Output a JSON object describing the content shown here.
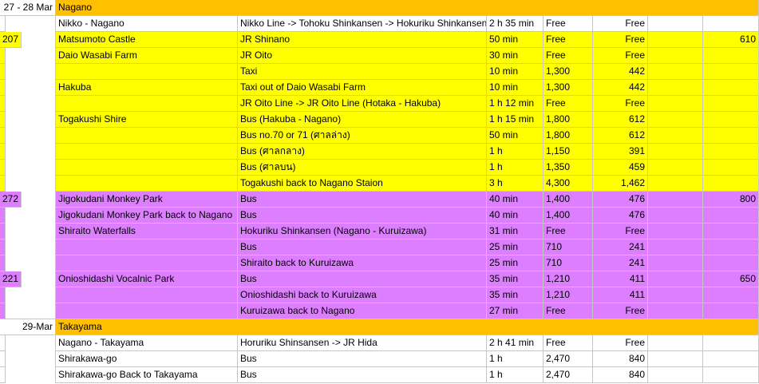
{
  "colors": {
    "header": "#ffc000",
    "nagano_block": "#ffff00",
    "monkey_block": "#dd7eff",
    "white": "#ffffff",
    "gridline": "#c6c6c6"
  },
  "rows": [
    {
      "bg": "header",
      "date": "27 - 28 Mar",
      "cells": [
        "Nagano",
        "",
        "",
        "",
        "",
        "",
        "",
        ""
      ]
    },
    {
      "bg": "white",
      "cells": [
        "Nikko - Nagano",
        "Nikko Line -> Tohoku Shinkansen -> Hokuriku Shinkansen",
        "2 h  35 min",
        "Free",
        "Free",
        "",
        "",
        ""
      ]
    },
    {
      "bg": "nagano_block",
      "cells": [
        "Matsumoto Castle",
        "JR Shinano",
        "50 min",
        "Free",
        "Free",
        "",
        "610",
        "207"
      ]
    },
    {
      "bg": "nagano_block",
      "cells": [
        "Daio Wasabi Farm",
        "JR Oito",
        "30 min",
        "Free",
        "Free",
        "",
        "",
        ""
      ]
    },
    {
      "bg": "nagano_block",
      "cells": [
        "",
        "Taxi",
        "10 min",
        "1,300",
        "442",
        "",
        "",
        ""
      ]
    },
    {
      "bg": "nagano_block",
      "cells": [
        "Hakuba",
        "Taxi out of Daio Wasabi Farm",
        "10 min",
        "1,300",
        "442",
        "",
        "",
        ""
      ]
    },
    {
      "bg": "nagano_block",
      "cells": [
        "",
        "JR Oito Line -> JR Oito Line (Hotaka - Hakuba)",
        "1 h  12 min",
        "Free",
        "Free",
        "",
        "",
        ""
      ]
    },
    {
      "bg": "nagano_block",
      "cells": [
        "Togakushi Shire",
        "Bus (Hakuba - Nagano)",
        "1 h  15 min",
        "1,800",
        "612",
        "",
        "",
        ""
      ]
    },
    {
      "bg": "nagano_block",
      "cells": [
        "",
        "Bus no.70 or 71 (ศาลล่าง)",
        "50 min",
        "1,800",
        "612",
        "",
        "",
        ""
      ]
    },
    {
      "bg": "nagano_block",
      "cells": [
        "",
        "Bus (ศาลกลาง)",
        "1 h",
        "1,150",
        "391",
        "",
        "",
        ""
      ]
    },
    {
      "bg": "nagano_block",
      "cells": [
        "",
        "Bus (ศาลบน)",
        "1 h",
        "1,350",
        "459",
        "",
        "",
        ""
      ]
    },
    {
      "bg": "nagano_block",
      "cells": [
        "",
        "Togakushi back to Nagano Staion",
        "3 h",
        "4,300",
        "1,462",
        "",
        "",
        ""
      ]
    },
    {
      "bg": "monkey_block",
      "cells": [
        "Jigokudani Monkey Park",
        "Bus",
        "40 min",
        "1,400",
        "476",
        "",
        "800",
        "272"
      ]
    },
    {
      "bg": "monkey_block",
      "cells": [
        "Jigokudani Monkey Park back to Nagano",
        "Bus",
        "40 min",
        "1,400",
        "476",
        "",
        "",
        ""
      ]
    },
    {
      "bg": "monkey_block",
      "cells": [
        "Shiraito Waterfalls",
        "Hokuriku Shinkansen (Nagano - Kuruizawa)",
        "31 min",
        "Free",
        "Free",
        "",
        "",
        ""
      ]
    },
    {
      "bg": "monkey_block",
      "cells": [
        "",
        "Bus",
        "25 min",
        "710",
        "241",
        "",
        "",
        ""
      ]
    },
    {
      "bg": "monkey_block",
      "cells": [
        "",
        "Shiraito back to Kuruizawa",
        "25 min",
        "710",
        "241",
        "",
        "",
        ""
      ]
    },
    {
      "bg": "monkey_block",
      "cells": [
        "Onioshidashi Vocalnic Park",
        "Bus",
        "35 min",
        "1,210",
        "411",
        "",
        "650",
        "221"
      ]
    },
    {
      "bg": "monkey_block",
      "cells": [
        "",
        "Onioshidashi back to Kuruizawa",
        "35 min",
        "1,210",
        "411",
        "",
        "",
        ""
      ]
    },
    {
      "bg": "monkey_block",
      "cells": [
        "",
        "Kuruizawa back to Nagano",
        "27 min",
        "Free",
        "Free",
        "",
        "",
        ""
      ]
    },
    {
      "bg": "header",
      "date": "29-Mar",
      "cells": [
        "Takayama",
        "",
        "",
        "",
        "",
        "",
        "",
        ""
      ]
    },
    {
      "bg": "white",
      "cells": [
        "Nagano - Takayama",
        "Horuriku Shinsansen -> JR Hida",
        "2 h  41 min",
        "Free",
        "Free",
        "",
        "",
        ""
      ]
    },
    {
      "bg": "white",
      "cells": [
        "Shirakawa-go",
        "Bus",
        "1 h",
        "2,470",
        "840",
        "",
        "",
        ""
      ]
    },
    {
      "bg": "white",
      "cells": [
        "Shirakawa-go Back to Takayama",
        "Bus",
        "1 h",
        "2,470",
        "840",
        "",
        "",
        ""
      ]
    }
  ]
}
